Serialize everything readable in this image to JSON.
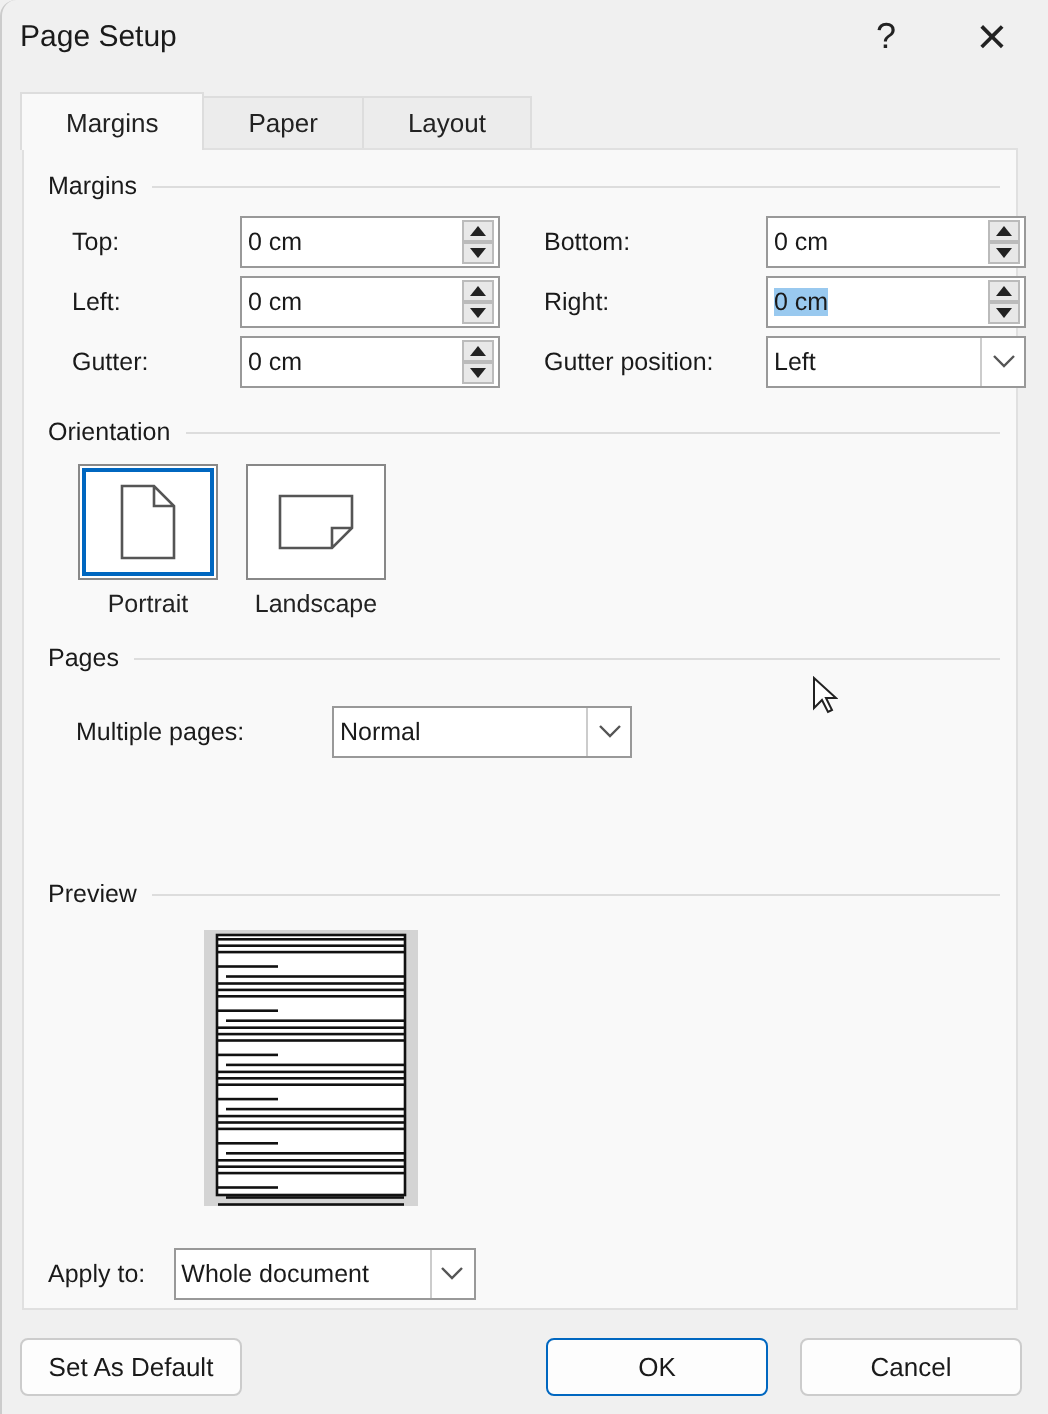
{
  "window": {
    "title": "Page Setup",
    "help": "?",
    "close": "×"
  },
  "tabs": [
    {
      "label": "Margins",
      "selected": true
    },
    {
      "label": "Paper",
      "selected": false
    },
    {
      "label": "Layout",
      "selected": false
    }
  ],
  "margins": {
    "heading": "Margins",
    "fields": [
      {
        "label": "Top:",
        "value": "0 cm",
        "kind": "spin",
        "text_selected": false
      },
      {
        "label": "Bottom:",
        "value": "0 cm",
        "kind": "spin",
        "text_selected": false
      },
      {
        "label": "Left:",
        "value": "0 cm",
        "kind": "spin",
        "text_selected": false
      },
      {
        "label": "Right:",
        "value": "0 cm",
        "kind": "spin",
        "text_selected": true
      },
      {
        "label": "Gutter:",
        "value": "0 cm",
        "kind": "spin",
        "text_selected": false
      },
      {
        "label": "Gutter position:",
        "value": "Left",
        "kind": "dropdown",
        "text_selected": false
      }
    ]
  },
  "orientation": {
    "heading": "Orientation",
    "options": [
      {
        "label": "Portrait",
        "kind": "portrait",
        "selected": true
      },
      {
        "label": "Landscape",
        "kind": "landscape",
        "selected": false
      }
    ]
  },
  "pages": {
    "heading": "Pages",
    "label": "Multiple pages:",
    "value": "Normal"
  },
  "preview": {
    "heading": "Preview",
    "apply_label": "Apply to:",
    "apply_value": "Whole document"
  },
  "buttons": [
    {
      "label": "Set As Default",
      "kind": "secondary"
    },
    {
      "label": "OK",
      "kind": "default"
    },
    {
      "label": "Cancel",
      "kind": "secondary"
    }
  ]
}
